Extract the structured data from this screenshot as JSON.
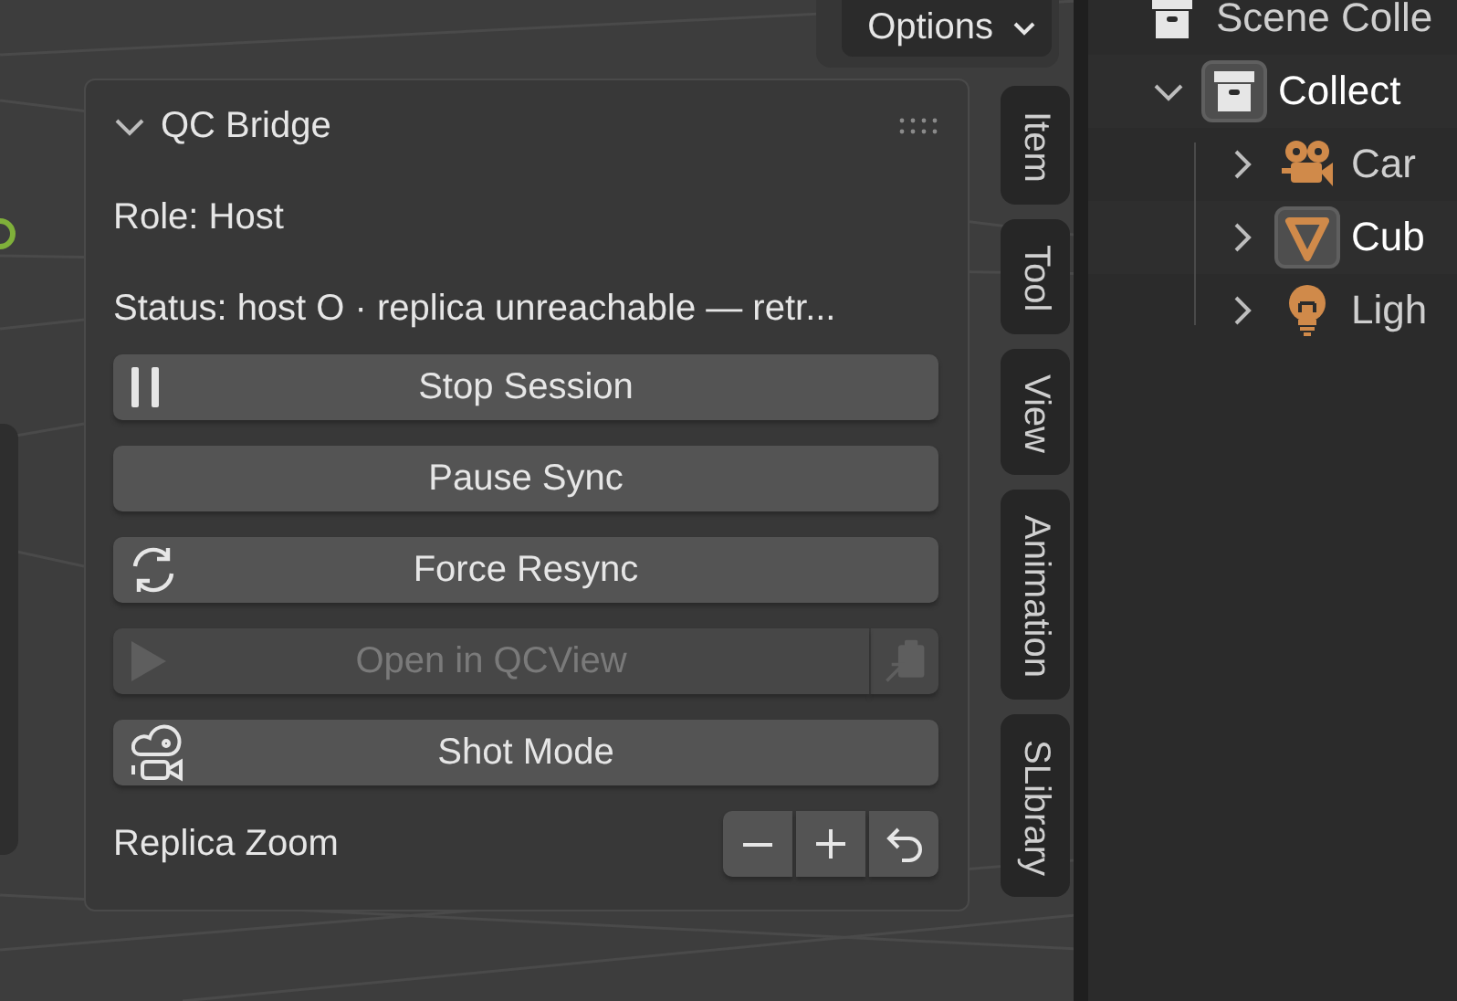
{
  "header": {
    "options_button": "Options"
  },
  "panel": {
    "title": "QC Bridge",
    "expanded": true,
    "role": "Role: Host",
    "status": "Status: host O · replica unreachable — retr...",
    "buttons": [
      {
        "label": "Stop Session",
        "kind": "pause",
        "disabled": false
      },
      {
        "label": "Pause Sync",
        "kind": "plain",
        "disabled": false
      },
      {
        "label": "Force Resync",
        "kind": "refresh",
        "disabled": false
      },
      {
        "label": "Open in QCView",
        "kind": "play",
        "disabled": true,
        "side_button": true
      },
      {
        "label": "Shot Mode",
        "kind": "camera",
        "disabled": false
      }
    ],
    "zoom": {
      "label": "Replica Zoom",
      "buttons": [
        {
          "kind": "minus"
        },
        {
          "kind": "plus"
        },
        {
          "kind": "reset"
        }
      ]
    }
  },
  "side_tabs": [
    {
      "label": "Item"
    },
    {
      "label": "Tool"
    },
    {
      "label": "View"
    },
    {
      "label": "Animation"
    },
    {
      "label": "SLibrary"
    }
  ],
  "outliner": {
    "items": [
      {
        "label": "Scene Colle",
        "kind": "collection",
        "active": false,
        "children": [
          {
            "label": "Collect",
            "kind": "collection",
            "active": true,
            "expanded": true,
            "children": [
              {
                "label": "Car",
                "kind": "camera",
                "active": false,
                "expanded": false
              },
              {
                "label": "Cub",
                "kind": "cone",
                "active": true,
                "expanded": false
              },
              {
                "label": "Ligh",
                "kind": "light",
                "active": false,
                "expanded": false
              }
            ]
          }
        ]
      }
    ]
  }
}
